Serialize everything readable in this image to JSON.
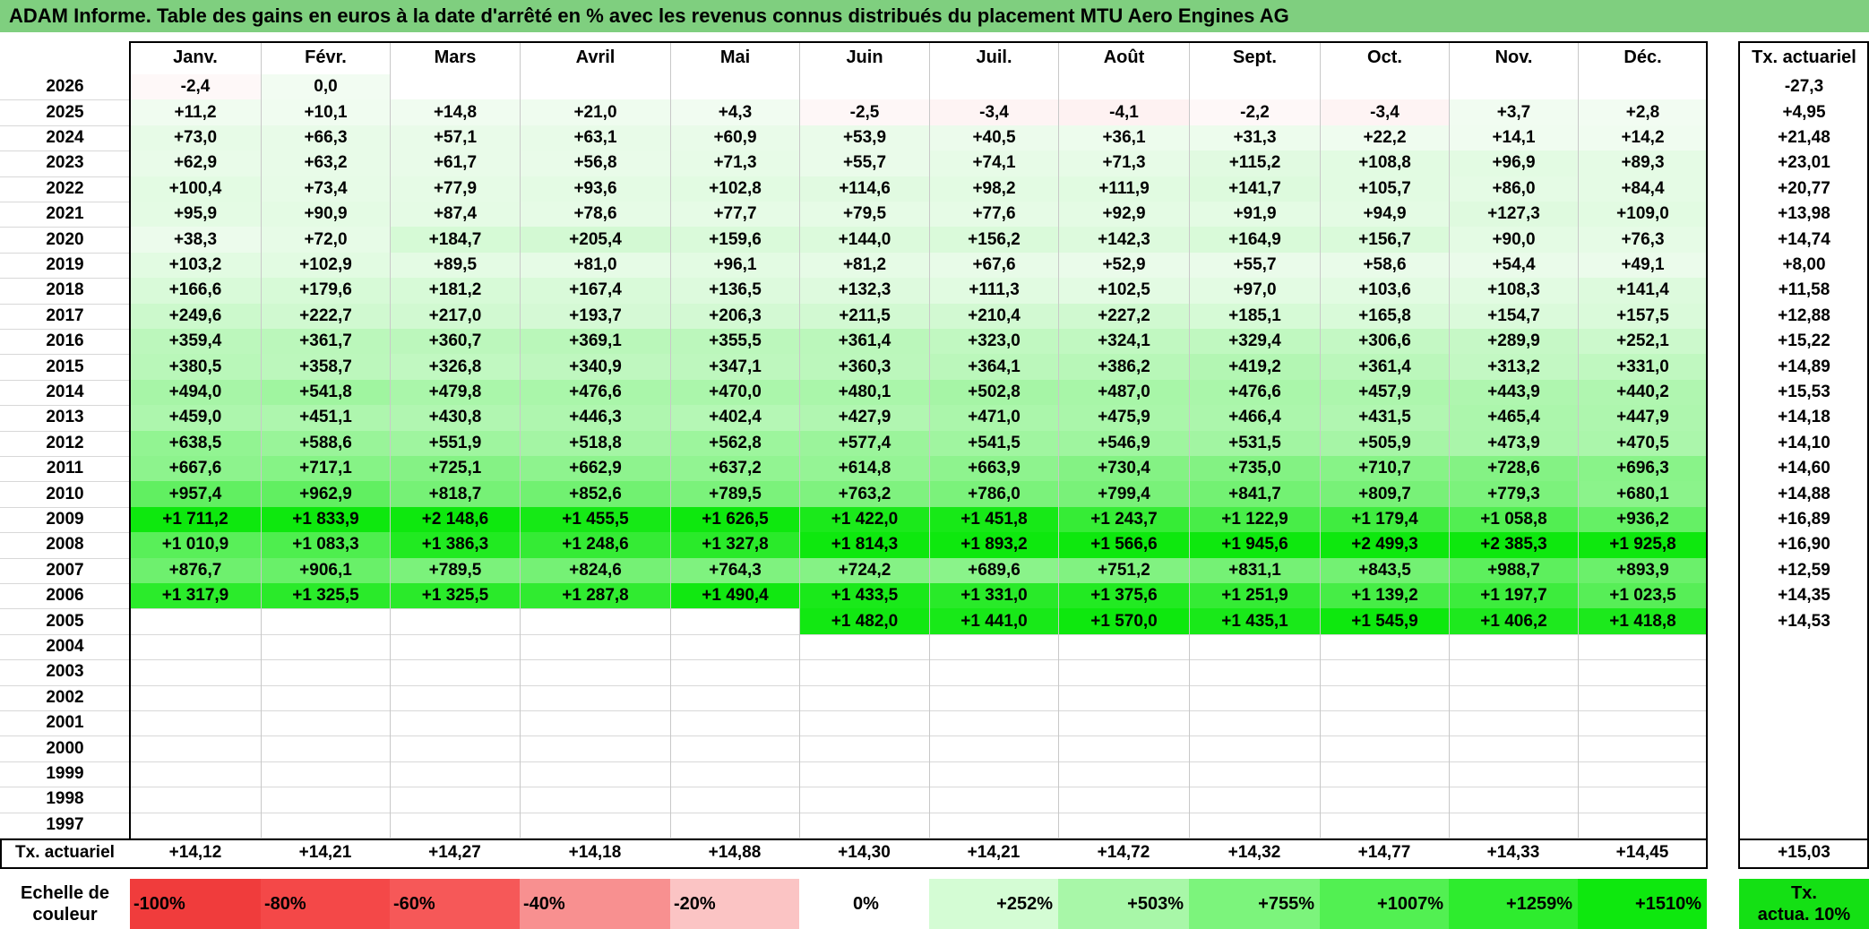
{
  "title": "ADAM Informe. Table des gains en euros à la date d'arrêté en % avec les revenus connus distribués du placement MTU Aero Engines AG",
  "chart_data": {
    "type": "table",
    "months": [
      "Janv.",
      "Févr.",
      "Mars",
      "Avril",
      "Mai",
      "Juin",
      "Juil.",
      "Août",
      "Sept.",
      "Oct.",
      "Nov.",
      "Déc."
    ],
    "rate_header": "Tx. actuariel",
    "rows": [
      {
        "year": "2026",
        "values": [
          -2.4,
          0.0,
          null,
          null,
          null,
          null,
          null,
          null,
          null,
          null,
          null,
          null
        ],
        "rate": "-27,3"
      },
      {
        "year": "2025",
        "values": [
          11.2,
          10.1,
          14.8,
          21.0,
          4.3,
          -2.5,
          -3.4,
          -4.1,
          -2.2,
          -3.4,
          3.7,
          2.8
        ],
        "rate": "+4,95"
      },
      {
        "year": "2024",
        "values": [
          73.0,
          66.3,
          57.1,
          63.1,
          60.9,
          53.9,
          40.5,
          36.1,
          31.3,
          22.2,
          14.1,
          14.2
        ],
        "rate": "+21,48"
      },
      {
        "year": "2023",
        "values": [
          62.9,
          63.2,
          61.7,
          56.8,
          71.3,
          55.7,
          74.1,
          71.3,
          115.2,
          108.8,
          96.9,
          89.3
        ],
        "rate": "+23,01"
      },
      {
        "year": "2022",
        "values": [
          100.4,
          73.4,
          77.9,
          93.6,
          102.8,
          114.6,
          98.2,
          111.9,
          141.7,
          105.7,
          86.0,
          84.4
        ],
        "rate": "+20,77"
      },
      {
        "year": "2021",
        "values": [
          95.9,
          90.9,
          87.4,
          78.6,
          77.7,
          79.5,
          77.6,
          92.9,
          91.9,
          94.9,
          127.3,
          109.0
        ],
        "rate": "+13,98"
      },
      {
        "year": "2020",
        "values": [
          38.3,
          72.0,
          184.7,
          205.4,
          159.6,
          144.0,
          156.2,
          142.3,
          164.9,
          156.7,
          90.0,
          76.3
        ],
        "rate": "+14,74"
      },
      {
        "year": "2019",
        "values": [
          103.2,
          102.9,
          89.5,
          81.0,
          96.1,
          81.2,
          67.6,
          52.9,
          55.7,
          58.6,
          54.4,
          49.1
        ],
        "rate": "+8,00"
      },
      {
        "year": "2018",
        "values": [
          166.6,
          179.6,
          181.2,
          167.4,
          136.5,
          132.3,
          111.3,
          102.5,
          97.0,
          103.6,
          108.3,
          141.4
        ],
        "rate": "+11,58"
      },
      {
        "year": "2017",
        "values": [
          249.6,
          222.7,
          217.0,
          193.7,
          206.3,
          211.5,
          210.4,
          227.2,
          185.1,
          165.8,
          154.7,
          157.5
        ],
        "rate": "+12,88"
      },
      {
        "year": "2016",
        "values": [
          359.4,
          361.7,
          360.7,
          369.1,
          355.5,
          361.4,
          323.0,
          324.1,
          329.4,
          306.6,
          289.9,
          252.1
        ],
        "rate": "+15,22"
      },
      {
        "year": "2015",
        "values": [
          380.5,
          358.7,
          326.8,
          340.9,
          347.1,
          360.3,
          364.1,
          386.2,
          419.2,
          361.4,
          313.2,
          331.0
        ],
        "rate": "+14,89"
      },
      {
        "year": "2014",
        "values": [
          494.0,
          541.8,
          479.8,
          476.6,
          470.0,
          480.1,
          502.8,
          487.0,
          476.6,
          457.9,
          443.9,
          440.2
        ],
        "rate": "+15,53"
      },
      {
        "year": "2013",
        "values": [
          459.0,
          451.1,
          430.8,
          446.3,
          402.4,
          427.9,
          471.0,
          475.9,
          466.4,
          431.5,
          465.4,
          447.9
        ],
        "rate": "+14,18"
      },
      {
        "year": "2012",
        "values": [
          638.5,
          588.6,
          551.9,
          518.8,
          562.8,
          577.4,
          541.5,
          546.9,
          531.5,
          505.9,
          473.9,
          470.5
        ],
        "rate": "+14,10"
      },
      {
        "year": "2011",
        "values": [
          667.6,
          717.1,
          725.1,
          662.9,
          637.2,
          614.8,
          663.9,
          730.4,
          735.0,
          710.7,
          728.6,
          696.3
        ],
        "rate": "+14,60"
      },
      {
        "year": "2010",
        "values": [
          957.4,
          962.9,
          818.7,
          852.6,
          789.5,
          763.2,
          786.0,
          799.4,
          841.7,
          809.7,
          779.3,
          680.1
        ],
        "rate": "+14,88"
      },
      {
        "year": "2009",
        "values": [
          1711.2,
          1833.9,
          2148.6,
          1455.5,
          1626.5,
          1422.0,
          1451.8,
          1243.7,
          1122.9,
          1179.4,
          1058.8,
          936.2
        ],
        "rate": "+16,89"
      },
      {
        "year": "2008",
        "values": [
          1010.9,
          1083.3,
          1386.3,
          1248.6,
          1327.8,
          1814.3,
          1893.2,
          1566.6,
          1945.6,
          2499.3,
          2385.3,
          1925.8
        ],
        "rate": "+16,90"
      },
      {
        "year": "2007",
        "values": [
          876.7,
          906.1,
          789.5,
          824.6,
          764.3,
          724.2,
          689.6,
          751.2,
          831.1,
          843.5,
          988.7,
          893.9
        ],
        "rate": "+12,59"
      },
      {
        "year": "2006",
        "values": [
          1317.9,
          1325.5,
          1325.5,
          1287.8,
          1490.4,
          1433.5,
          1331.0,
          1375.6,
          1251.9,
          1139.2,
          1197.7,
          1023.5
        ],
        "rate": "+14,35"
      },
      {
        "year": "2005",
        "values": [
          null,
          null,
          null,
          null,
          null,
          1482.0,
          1441.0,
          1570.0,
          1435.1,
          1545.9,
          1406.2,
          1418.8
        ],
        "rate": "+14,53"
      },
      {
        "year": "2004",
        "values": [
          null,
          null,
          null,
          null,
          null,
          null,
          null,
          null,
          null,
          null,
          null,
          null
        ],
        "rate": ""
      },
      {
        "year": "2003",
        "values": [
          null,
          null,
          null,
          null,
          null,
          null,
          null,
          null,
          null,
          null,
          null,
          null
        ],
        "rate": ""
      },
      {
        "year": "2002",
        "values": [
          null,
          null,
          null,
          null,
          null,
          null,
          null,
          null,
          null,
          null,
          null,
          null
        ],
        "rate": ""
      },
      {
        "year": "2001",
        "values": [
          null,
          null,
          null,
          null,
          null,
          null,
          null,
          null,
          null,
          null,
          null,
          null
        ],
        "rate": ""
      },
      {
        "year": "2000",
        "values": [
          null,
          null,
          null,
          null,
          null,
          null,
          null,
          null,
          null,
          null,
          null,
          null
        ],
        "rate": ""
      },
      {
        "year": "1999",
        "values": [
          null,
          null,
          null,
          null,
          null,
          null,
          null,
          null,
          null,
          null,
          null,
          null
        ],
        "rate": ""
      },
      {
        "year": "1998",
        "values": [
          null,
          null,
          null,
          null,
          null,
          null,
          null,
          null,
          null,
          null,
          null,
          null
        ],
        "rate": ""
      },
      {
        "year": "1997",
        "values": [
          null,
          null,
          null,
          null,
          null,
          null,
          null,
          null,
          null,
          null,
          null,
          null
        ],
        "rate": ""
      }
    ],
    "footer": {
      "label": "Tx. actuariel",
      "values": [
        "+14,12",
        "+14,21",
        "+14,27",
        "+14,18",
        "+14,88",
        "+14,30",
        "+14,21",
        "+14,72",
        "+14,32",
        "+14,77",
        "+14,33",
        "+14,45"
      ],
      "rate": "+15,03"
    },
    "color_scale": {
      "label_line1": "Echelle de",
      "label_line2": "couleur",
      "steps": [
        {
          "label": "-100%",
          "color": "#f03c3c"
        },
        {
          "label": "-80%",
          "color": "#f44848"
        },
        {
          "label": "-60%",
          "color": "#f65858"
        },
        {
          "label": "-40%",
          "color": "#f89090"
        },
        {
          "label": "-20%",
          "color": "#fbc4c4"
        },
        {
          "label": "0%",
          "color": "#ffffff"
        },
        {
          "label": "+252%",
          "color": "#d4fcd4"
        },
        {
          "label": "+503%",
          "color": "#a8f7a8"
        },
        {
          "label": "+755%",
          "color": "#7cf47c"
        },
        {
          "label": "+1007%",
          "color": "#52f052"
        },
        {
          "label": "+1259%",
          "color": "#2eec2e"
        },
        {
          "label": "+1510%",
          "color": "#0ee80e"
        }
      ],
      "rate_line1": "Tx.",
      "rate_line2": "actua. 10%",
      "rate_color": "#14e014"
    }
  }
}
